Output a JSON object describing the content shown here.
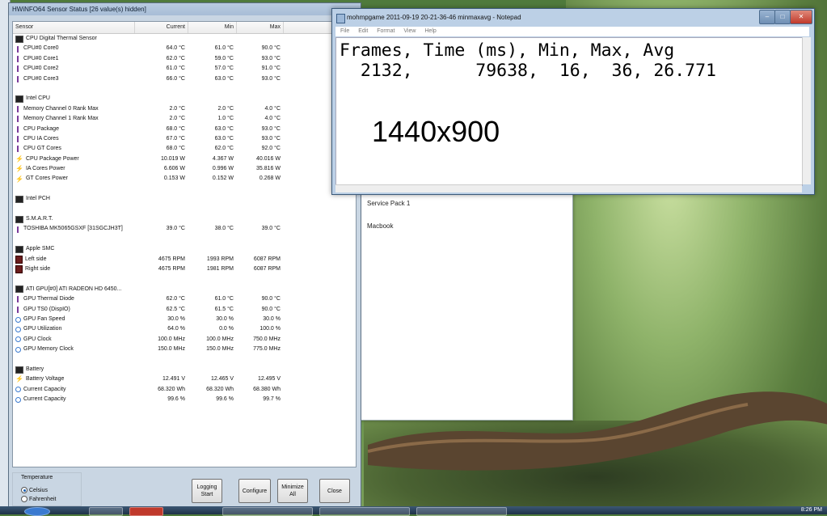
{
  "hwinfo": {
    "title": "HWiNFO64 Sensor Status [26 value(s) hidden]",
    "columns": [
      "Sensor",
      "Current",
      "Min",
      "Max"
    ],
    "rows": [
      {
        "kind": "group",
        "icon": "chip",
        "name": "CPU Digital Thermal Sensor"
      },
      {
        "kind": "data",
        "icon": "therm",
        "name": "CPU#0 Core0",
        "cur": "64.0 °C",
        "min": "61.0 °C",
        "max": "90.0 °C"
      },
      {
        "kind": "data",
        "icon": "therm",
        "name": "CPU#0 Core1",
        "cur": "62.0 °C",
        "min": "59.0 °C",
        "max": "93.0 °C"
      },
      {
        "kind": "data",
        "icon": "therm",
        "name": "CPU#0 Core2",
        "cur": "61.0 °C",
        "min": "57.0 °C",
        "max": "91.0 °C"
      },
      {
        "kind": "data",
        "icon": "therm",
        "name": "CPU#0 Core3",
        "cur": "66.0 °C",
        "min": "63.0 °C",
        "max": "93.0 °C"
      },
      {
        "kind": "blank"
      },
      {
        "kind": "group",
        "icon": "chip",
        "name": "Intel CPU"
      },
      {
        "kind": "data",
        "icon": "therm",
        "name": "Memory Channel 0 Rank Max",
        "cur": "2.0 °C",
        "min": "2.0 °C",
        "max": "4.0 °C"
      },
      {
        "kind": "data",
        "icon": "therm",
        "name": "Memory Channel 1 Rank Max",
        "cur": "2.0 °C",
        "min": "1.0 °C",
        "max": "4.0 °C"
      },
      {
        "kind": "data",
        "icon": "therm",
        "name": "CPU Package",
        "cur": "68.0 °C",
        "min": "63.0 °C",
        "max": "93.0 °C"
      },
      {
        "kind": "data",
        "icon": "therm",
        "name": "CPU IA Cores",
        "cur": "67.0 °C",
        "min": "63.0 °C",
        "max": "93.0 °C"
      },
      {
        "kind": "data",
        "icon": "therm",
        "name": "CPU GT Cores",
        "cur": "68.0 °C",
        "min": "62.0 °C",
        "max": "92.0 °C"
      },
      {
        "kind": "data",
        "icon": "bolt",
        "name": "CPU Package Power",
        "cur": "10.019 W",
        "min": "4.367 W",
        "max": "40.016 W"
      },
      {
        "kind": "data",
        "icon": "bolt",
        "name": "IA Cores Power",
        "cur": "6.606 W",
        "min": "0.996 W",
        "max": "35.816 W"
      },
      {
        "kind": "data",
        "icon": "bolt",
        "name": "GT Cores Power",
        "cur": "0.153 W",
        "min": "0.152 W",
        "max": "0.268 W"
      },
      {
        "kind": "blank"
      },
      {
        "kind": "group",
        "icon": "chip",
        "name": "Intel PCH"
      },
      {
        "kind": "blank"
      },
      {
        "kind": "group",
        "icon": "chip",
        "name": "S.M.A.R.T."
      },
      {
        "kind": "data",
        "icon": "therm",
        "name": "TOSHIBA MK5065GSXF [31SGCJH3T]",
        "cur": "39.0 °C",
        "min": "38.0 °C",
        "max": "39.0 °C"
      },
      {
        "kind": "blank"
      },
      {
        "kind": "group",
        "icon": "chip",
        "name": "Apple SMC"
      },
      {
        "kind": "data",
        "icon": "smc",
        "name": "Left side",
        "cur": "4675 RPM",
        "min": "1993 RPM",
        "max": "6087 RPM"
      },
      {
        "kind": "data",
        "icon": "smc",
        "name": "Right side",
        "cur": "4675 RPM",
        "min": "1981 RPM",
        "max": "6087 RPM"
      },
      {
        "kind": "blank"
      },
      {
        "kind": "group",
        "icon": "chip",
        "name": "ATI GPU[#0] ATI RADEON HD 6450..."
      },
      {
        "kind": "data",
        "icon": "therm",
        "name": "GPU Thermal Diode",
        "cur": "62.0 °C",
        "min": "61.0 °C",
        "max": "90.0 °C"
      },
      {
        "kind": "data",
        "icon": "therm",
        "name": "GPU TS0 (DispIO)",
        "cur": "62.5 °C",
        "min": "61.5 °C",
        "max": "90.0 °C"
      },
      {
        "kind": "data",
        "icon": "fan",
        "name": "GPU Fan Speed",
        "cur": "30.0 %",
        "min": "30.0 %",
        "max": "30.0 %"
      },
      {
        "kind": "data",
        "icon": "fan",
        "name": "GPU Utilization",
        "cur": "64.0 %",
        "min": "0.0 %",
        "max": "100.0 %"
      },
      {
        "kind": "data",
        "icon": "fan",
        "name": "GPU Clock",
        "cur": "100.0 MHz",
        "min": "100.0 MHz",
        "max": "750.0 MHz"
      },
      {
        "kind": "data",
        "icon": "fan",
        "name": "GPU Memory Clock",
        "cur": "150.0 MHz",
        "min": "150.0 MHz",
        "max": "775.0 MHz"
      },
      {
        "kind": "blank"
      },
      {
        "kind": "group",
        "icon": "chip",
        "name": "Battery"
      },
      {
        "kind": "data",
        "icon": "bolt",
        "name": "Battery Voltage",
        "cur": "12.491 V",
        "min": "12.465 V",
        "max": "12.495 V"
      },
      {
        "kind": "data",
        "icon": "fan",
        "name": "Current Capacity",
        "cur": "68.320 Wh",
        "min": "68.320 Wh",
        "max": "68.380 Wh"
      },
      {
        "kind": "data",
        "icon": "fan",
        "name": "Current Capacity",
        "cur": "99.6 %",
        "min": "99.6 %",
        "max": "99.7 %"
      }
    ],
    "temperature_label": "Temperature",
    "celsius_label": "Celsius",
    "fahrenheit_label": "Fahrenheit",
    "logging_label_1": "Logging",
    "logging_label_2": "Start",
    "configure_label": "Configure",
    "minimize_label_1": "Minimize",
    "minimize_label_2": "All",
    "close_label": "Close"
  },
  "notepad": {
    "title": "mohmpgame 2011-09-19 20-21-36-46 minmaxavg - Notepad",
    "menu": [
      "File",
      "Edit",
      "Format",
      "View",
      "Help"
    ],
    "line1": "Frames, Time (ms), Min, Max, Avg",
    "line2": "  2132,      79638,  16,  36, 26.771",
    "big_text": "1440x900"
  },
  "background_window": {
    "line1": "Service Pack 1",
    "line2": "Macbook"
  },
  "taskbar": {
    "clock": "8:26 PM"
  }
}
